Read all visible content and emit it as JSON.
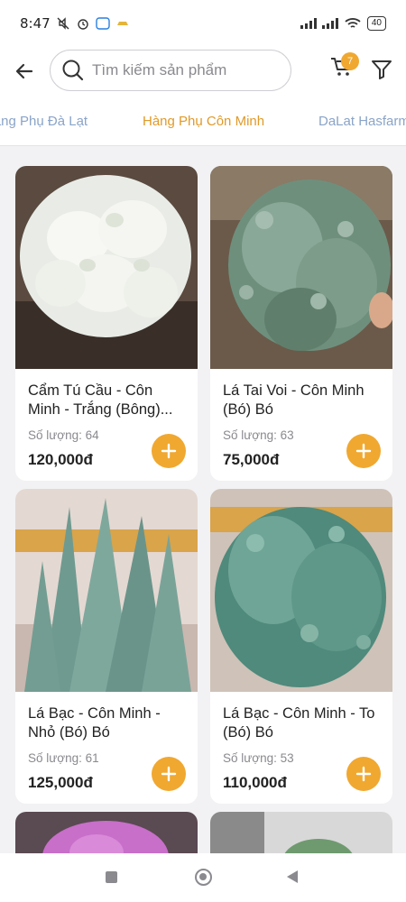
{
  "status_bar": {
    "time": "8:47",
    "battery": "40"
  },
  "search": {
    "placeholder": "Tìm kiếm sản phẩm"
  },
  "cart": {
    "badge_count": "7"
  },
  "tabs": [
    {
      "label": "Hàng Phụ Đà Lạt"
    },
    {
      "label": "Hàng Phụ Côn Minh"
    },
    {
      "label": "DaLat Hasfarm"
    }
  ],
  "products": [
    {
      "name": "Cẩm Tú Cầu - Côn Minh - Trắng (Bông)...",
      "qty": "Số lượng: 64",
      "price": "120,000đ"
    },
    {
      "name": "Lá Tai Voi - Côn Minh (Bó) Bó",
      "qty": "Số lượng: 63",
      "price": "75,000đ"
    },
    {
      "name": "Lá Bạc - Côn Minh - Nhỏ (Bó) Bó",
      "qty": "Số lượng: 61",
      "price": "125,000đ"
    },
    {
      "name": "Lá Bạc - Côn Minh - To (Bó) Bó",
      "qty": "Số lượng: 53",
      "price": "110,000đ"
    }
  ],
  "colors": {
    "accent": "#f0a830",
    "tab_active": "#e09a2a",
    "tab_inactive": "#8aa4c8"
  }
}
